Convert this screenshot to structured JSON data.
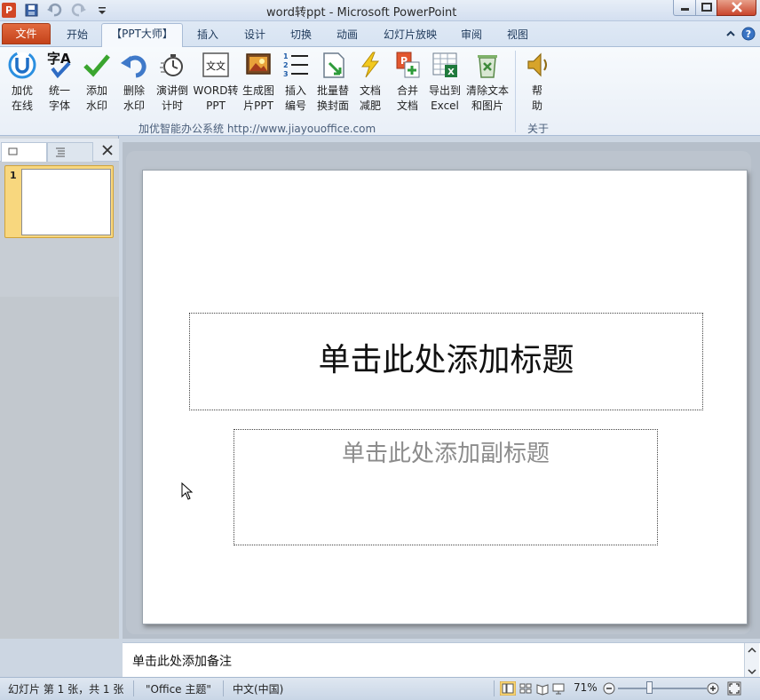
{
  "app": {
    "icon_letter": "P",
    "title": "word转ppt  -  Microsoft PowerPoint"
  },
  "tabs": [
    {
      "label": "文件"
    },
    {
      "label": "开始"
    },
    {
      "label": "【PPT大师】"
    },
    {
      "label": "插入"
    },
    {
      "label": "设计"
    },
    {
      "label": "切换"
    },
    {
      "label": "动画"
    },
    {
      "label": "幻灯片放映"
    },
    {
      "label": "审阅"
    },
    {
      "label": "视图"
    }
  ],
  "ribbon": {
    "buttons": [
      {
        "label": "加优\n在线",
        "icon": "jiayou-online-icon"
      },
      {
        "label": "统一\n字体",
        "icon": "unify-font-icon"
      },
      {
        "label": "添加\n水印",
        "icon": "add-watermark-icon"
      },
      {
        "label": "删除\n水印",
        "icon": "remove-watermark-icon"
      },
      {
        "label": "演讲倒\n计时",
        "icon": "countdown-timer-icon"
      },
      {
        "label": "WORD转\nPPT",
        "icon": "word-to-ppt-icon"
      },
      {
        "label": "生成图\n片PPT",
        "icon": "image-ppt-icon"
      },
      {
        "label": "插入\n编号",
        "icon": "insert-numbering-icon"
      },
      {
        "label": "批量替\n换封面",
        "icon": "batch-cover-icon"
      },
      {
        "label": "文档\n减肥",
        "icon": "slim-document-icon"
      },
      {
        "label": "合并\n文档",
        "icon": "merge-documents-icon"
      },
      {
        "label": "导出到\nExcel",
        "icon": "export-excel-icon"
      },
      {
        "label": "清除文本\n和图片",
        "icon": "clear-text-images-icon"
      },
      {
        "label": "帮\n助",
        "icon": "help-speaker-icon"
      }
    ],
    "group_main_label": "加优智能办公系统   http://www.jiayouoffice.com",
    "group_about_label": "关于"
  },
  "left_pane": {
    "slide_number": "1"
  },
  "slide": {
    "title_placeholder": "单击此处添加标题",
    "subtitle_placeholder": "单击此处添加副标题"
  },
  "notes": {
    "placeholder": "单击此处添加备注"
  },
  "status": {
    "slide_info": "幻灯片 第 1 张，共 1 张",
    "theme": "\"Office 主题\"",
    "language": "中文(中国)",
    "zoom": "71%"
  }
}
